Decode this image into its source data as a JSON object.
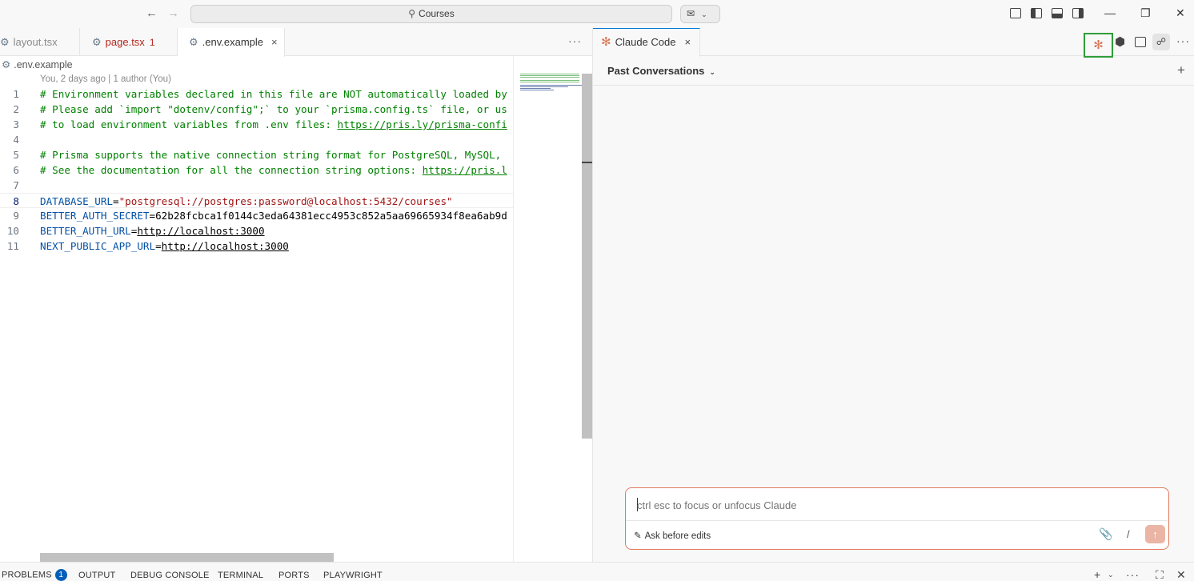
{
  "titlebar": {
    "search_text": "Courses",
    "back_icon": "arrow-left-icon",
    "forward_icon": "arrow-right-icon"
  },
  "editor_tabs": [
    {
      "label": "layout.tsx"
    },
    {
      "label": "page.tsx",
      "problems": "1"
    },
    {
      "label": ".env.example",
      "close": "×"
    }
  ],
  "tabs_more": "···",
  "breadcrumb": ".env.example",
  "blame": "You, 2 days ago | 1 author (You)",
  "code_lines": [
    {
      "n": "1",
      "text": "# Environment variables declared in this file are NOT automatically loaded by"
    },
    {
      "n": "2",
      "text": "# Please add `import \"dotenv/config\";` to your `prisma.config.ts` file, or us"
    },
    {
      "n": "3",
      "pre": "# to load environment variables from .env files: ",
      "link": "https://pris.ly/prisma-confi"
    },
    {
      "n": "4",
      "text": ""
    },
    {
      "n": "5",
      "text": "# Prisma supports the native connection string format for PostgreSQL, MySQL,"
    },
    {
      "n": "6",
      "pre": "# See the documentation for all the connection string options: ",
      "link": "https://pris.l"
    },
    {
      "n": "7",
      "text": ""
    },
    {
      "n": "8",
      "key": "DATABASE_URL",
      "value": "\"postgresql://postgres:password@localhost:5432/courses\""
    },
    {
      "n": "9",
      "key": "BETTER_AUTH_SECRET",
      "value": "62b28fcbca1f0144c3eda64381ecc4953c852a5aa69665934f8ea6ab9d"
    },
    {
      "n": "10",
      "key": "BETTER_AUTH_URL",
      "value": "http://localhost:3000"
    },
    {
      "n": "11",
      "key": "NEXT_PUBLIC_APP_URL",
      "value": "http://localhost:3000"
    }
  ],
  "claude": {
    "tab_label": "Claude Code",
    "tab_close": "×",
    "past_conversations": "Past Conversations",
    "new_chat": "+",
    "input_placeholder": "ctrl esc to focus or unfocus Claude",
    "mode_label": "Ask before edits",
    "slash": "/",
    "more": "···"
  },
  "panel_tabs": {
    "problems": "PROBLEMS",
    "problems_count": "1",
    "output": "OUTPUT",
    "debug_console": "DEBUG CONSOLE",
    "terminal": "TERMINAL",
    "ports": "PORTS",
    "playwright": "PLAYWRIGHT"
  },
  "colors": {
    "accent": "#0078d4",
    "claude_orange": "#d97757",
    "comment_green": "#008000",
    "string_red": "#a31515",
    "key_blue": "#0451a5",
    "highlight_green": "#2e9e3a"
  }
}
